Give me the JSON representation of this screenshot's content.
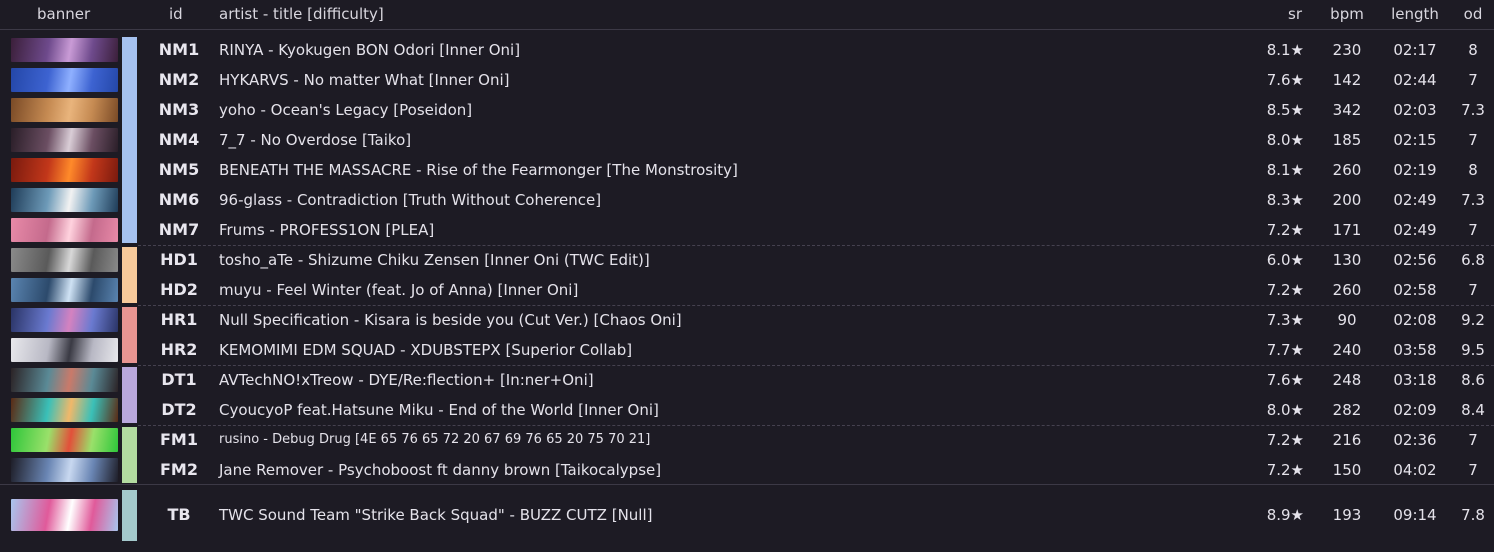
{
  "columns": {
    "banner": "banner",
    "id": "id",
    "title": "artist - title [difficulty]",
    "sr": "sr",
    "bpm": "bpm",
    "length": "length",
    "od": "od"
  },
  "colors": {
    "NM": "#a6c2f0",
    "HD": "#f7c99a",
    "HR": "#e89592",
    "DT": "#b9a8dc",
    "FM": "#b2dba0",
    "TB": "#a4c9cc"
  },
  "rows": [
    {
      "id": "NM1",
      "title": "RINYA - Kyokugen BON Odori [Inner Oni]",
      "sr": "8.1★",
      "bpm": "230",
      "length": "02:17",
      "od": "8",
      "banner": [
        "#3b1f3a",
        "#c99bd6",
        "#6e4a8c"
      ]
    },
    {
      "id": "NM2",
      "title": "HYKARVS - No matter What [Inner Oni]",
      "sr": "7.6★",
      "bpm": "142",
      "length": "02:44",
      "od": "7",
      "banner": [
        "#2447a8",
        "#8fb0ff",
        "#3d63d1"
      ]
    },
    {
      "id": "NM3",
      "title": "yoho - Ocean's Legacy [Poseidon]",
      "sr": "8.5★",
      "bpm": "342",
      "length": "02:03",
      "od": "7.3",
      "banner": [
        "#7a4a26",
        "#e9b47c",
        "#c58a52"
      ]
    },
    {
      "id": "NM4",
      "title": "7_7 - No Overdose [Taiko]",
      "sr": "8.0★",
      "bpm": "185",
      "length": "02:15",
      "od": "7",
      "banner": [
        "#2a1e28",
        "#d9cdd6",
        "#6b4e62"
      ]
    },
    {
      "id": "NM5",
      "title": "BENEATH THE MASSACRE - Rise of the Fearmonger [The Monstrosity]",
      "sr": "8.1★",
      "bpm": "260",
      "length": "02:19",
      "od": "8",
      "banner": [
        "#7a1a0e",
        "#ff8a2a",
        "#c2371a"
      ]
    },
    {
      "id": "NM6",
      "title": "96-glass - Contradiction [Truth Without Coherence]",
      "sr": "8.3★",
      "bpm": "200",
      "length": "02:49",
      "od": "7.3",
      "banner": [
        "#1f3c58",
        "#f2f2f2",
        "#6d9ab8"
      ]
    },
    {
      "id": "NM7",
      "title": "Frums - PROFESS1ON [PLEA]",
      "sr": "7.2★",
      "bpm": "171",
      "length": "02:49",
      "od": "7",
      "banner": [
        "#e88aa8",
        "#ffd2de",
        "#c46a8c"
      ]
    },
    {
      "id": "HD1",
      "title": "tosho_aTe - Shizume Chiku Zensen [Inner Oni (TWC Edit)]",
      "sr": "6.0★",
      "bpm": "130",
      "length": "02:56",
      "od": "6.8",
      "banner": [
        "#8a8a8a",
        "#d8d8d8",
        "#5a5a5a"
      ]
    },
    {
      "id": "HD2",
      "title": "muyu - Feel Winter (feat. Jo of Anna) [Inner Oni]",
      "sr": "7.2★",
      "bpm": "260",
      "length": "02:58",
      "od": "7",
      "banner": [
        "#5a84b0",
        "#cfe2f4",
        "#2c4a6c"
      ]
    },
    {
      "id": "HR1",
      "title": "Null Specification - Kisara is beside you (Cut Ver.) [Chaos Oni]",
      "sr": "7.3★",
      "bpm": "90",
      "length": "02:08",
      "od": "9.2",
      "banner": [
        "#2a3466",
        "#d482c0",
        "#6a7ad0"
      ]
    },
    {
      "id": "HR2",
      "title": "KEMOMIMI EDM SQUAD - XDUBSTEPX [Superior Collab]",
      "sr": "7.7★",
      "bpm": "240",
      "length": "03:58",
      "od": "9.5",
      "banner": [
        "#e8e8ec",
        "#3a3a44",
        "#b8b8c4"
      ]
    },
    {
      "id": "DT1",
      "title": "AVTechNO!xTreow - DYE/Re:flection+ [In:ner+Oni]",
      "sr": "7.6★",
      "bpm": "248",
      "length": "03:18",
      "od": "8.6",
      "banner": [
        "#2b2326",
        "#c97a6a",
        "#5a8a96"
      ]
    },
    {
      "id": "DT2",
      "title": "CyoucyoP feat.Hatsune Miku - End of the World [Inner Oni]",
      "sr": "8.0★",
      "bpm": "282",
      "length": "02:09",
      "od": "8.4",
      "banner": [
        "#5a2a14",
        "#f0b86a",
        "#3ac0b8"
      ]
    },
    {
      "id": "FM1",
      "title": "rusino - Debug Drug [4E 65 76 65 72 20 67 69 76 65 20 75 70 21]",
      "small": true,
      "sr": "7.2★",
      "bpm": "216",
      "length": "02:36",
      "od": "7",
      "banner": [
        "#2ec63a",
        "#e2503a",
        "#9ae06a"
      ]
    },
    {
      "id": "FM2",
      "title": "Jane Remover - Psychoboost ft danny brown [Taikocalypse]",
      "sr": "7.2★",
      "bpm": "150",
      "length": "04:02",
      "od": "7",
      "banner": [
        "#1e1e28",
        "#c8d8f0",
        "#6a86b4"
      ]
    },
    {
      "id": "TB",
      "title": "TWC Sound Team \"Strike Back Squad\" - BUZZ CUTZ [Null]",
      "sr": "8.9★",
      "bpm": "193",
      "length": "09:14",
      "od": "7.8",
      "banner": [
        "#a8c6ee",
        "#ffffff",
        "#e05a9a"
      ]
    }
  ]
}
